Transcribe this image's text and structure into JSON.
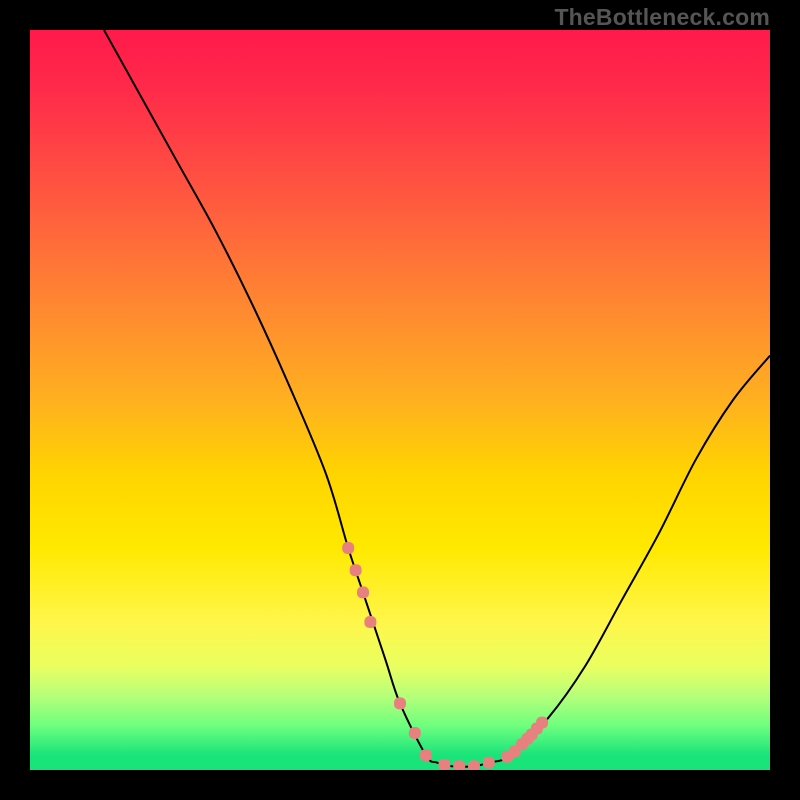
{
  "watermark": "TheBottleneck.com",
  "chart_data": {
    "type": "line",
    "title": "",
    "xlabel": "",
    "ylabel": "",
    "xlim": [
      0,
      100
    ],
    "ylim": [
      0,
      100
    ],
    "series": [
      {
        "name": "curve",
        "x": [
          10,
          15,
          20,
          25,
          30,
          35,
          40,
          43,
          45,
          48,
          50,
          53.5,
          55,
          57,
          60,
          62,
          65,
          70,
          75,
          80,
          85,
          90,
          95,
          100
        ],
        "values": [
          100,
          91,
          82,
          73,
          63,
          52,
          40,
          30,
          24,
          15,
          9,
          2,
          1,
          0.5,
          0.5,
          1,
          2,
          7,
          14,
          23,
          32,
          42,
          50,
          56
        ]
      }
    ],
    "markers": {
      "name": "highlight-dots",
      "color": "#e88080",
      "x": [
        43,
        44,
        45,
        46,
        50,
        52,
        53.5,
        56,
        58,
        60,
        62,
        64.5,
        65.5,
        66.5,
        67.2,
        67.8,
        68.5,
        69.2
      ],
      "values": [
        30,
        27,
        24,
        20,
        9,
        5,
        2,
        0.7,
        0.5,
        0.5,
        1,
        1.8,
        2.5,
        3.5,
        4.2,
        4.8,
        5.6,
        6.4
      ]
    },
    "background": "vertical-heat-gradient (red top → green bottom)"
  }
}
